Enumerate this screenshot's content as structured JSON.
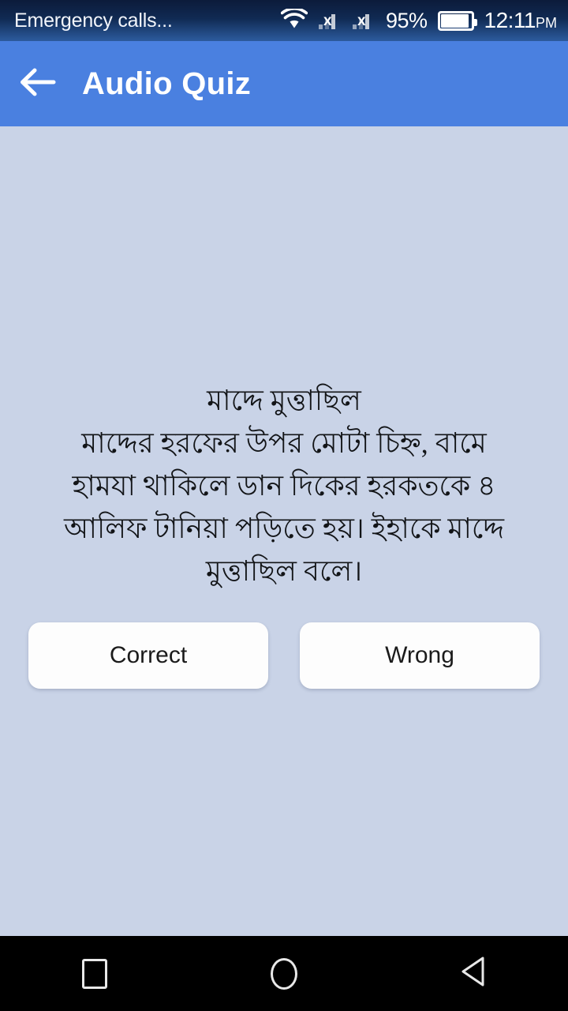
{
  "status_bar": {
    "carrier": "Emergency calls...",
    "wifi_icon": "wifi-icon",
    "signal_icon_1": "cellular-no-service-icon",
    "signal_icon_2": "cellular-no-service-icon",
    "signal_x_label": "x",
    "battery_percent": "95%",
    "battery_icon": "battery-full-icon",
    "time": "12:11",
    "time_period": "PM",
    "background_color": "#102a53",
    "text_color": "#ffffff"
  },
  "app_bar": {
    "back_icon": "arrow-left-icon",
    "title": "Audio Quiz",
    "background_color": "#4a80e0",
    "text_color": "#ffffff"
  },
  "content": {
    "background_color": "#c9d3e7",
    "question_text": "মাদ্দে মুত্তাছিল\nমাদ্দের হরফের উপর  মোটা চিহ্ন, বামে\nহামযা থাকিলে ডান দিকের হরকতকে  ৪\nআলিফ টানিয়া পড়িতে হয়। ইহাকে  মাদ্দে\nমুত্তাছিল বলে।",
    "question_lines": [
      "মাদ্দে মুত্তাছিল",
      "মাদ্দের হরফের উপর  মোটা চিহ্ন, বামে",
      "হামযা থাকিলে ডান দিকের হরকতকে  ৪",
      "আলিফ টানিয়া পড়িতে হয়। ইহাকে  মাদ্দে",
      "মুত্তাছিল বলে।"
    ],
    "text_color": "#121417"
  },
  "answers": {
    "correct_label": "Correct",
    "wrong_label": "Wrong",
    "button_background": "#fdfdfd",
    "button_text_color": "#1b1b1b"
  },
  "nav_bar": {
    "recents_icon": "square-recents-icon",
    "home_icon": "circle-home-icon",
    "back_icon": "triangle-back-icon",
    "background_color": "#000000",
    "icon_color": "#e8e8e8"
  }
}
